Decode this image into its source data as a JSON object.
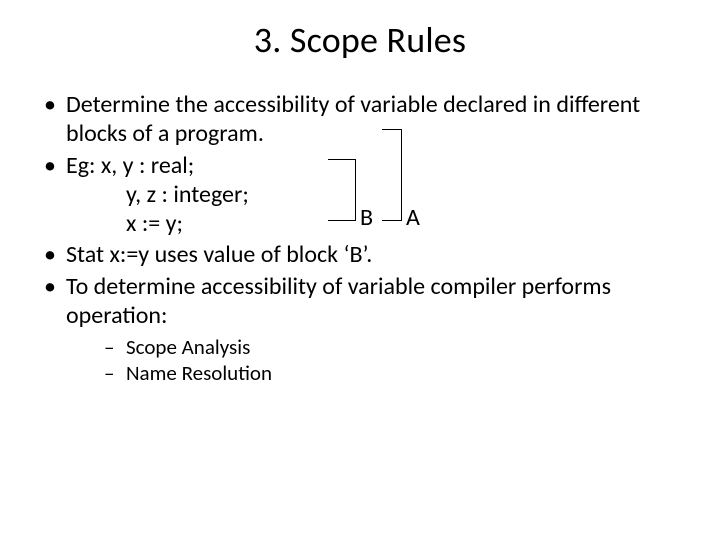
{
  "title": "3. Scope Rules",
  "bullets": {
    "b1": "Determine the accessibility of variable declared in different blocks of a program.",
    "b2": "Eg: x, y : real;",
    "b2a": "y, z : integer;",
    "b2b": "x := y;",
    "b3": "Stat x:=y uses value of block ‘B’.",
    "b4": "To determine accessibility of variable compiler performs operation:"
  },
  "sub": {
    "s1": "Scope Analysis",
    "s2": "Name Resolution"
  },
  "labels": {
    "B": "B",
    "A": "A"
  }
}
